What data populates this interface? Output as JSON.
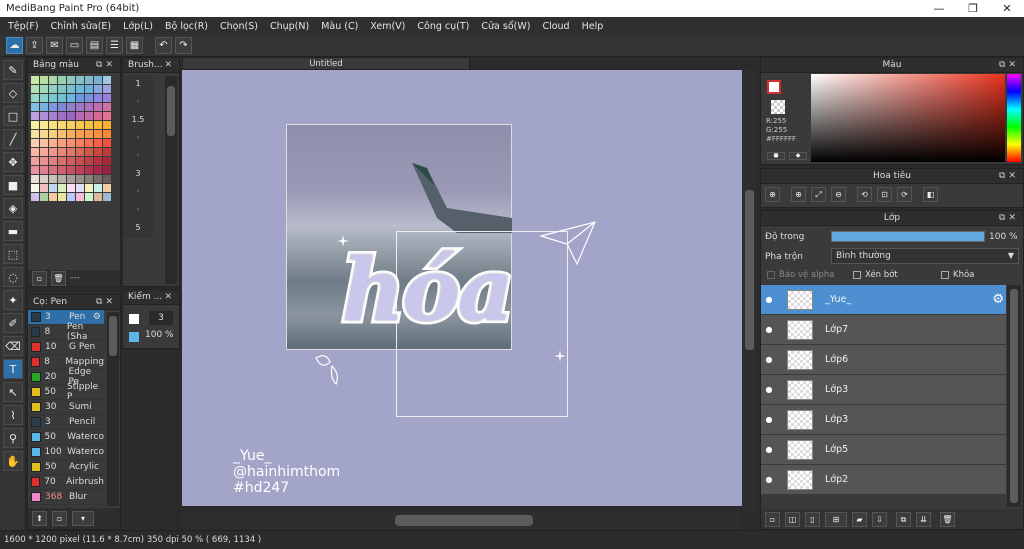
{
  "window": {
    "title": "MediBang Paint Pro (64bit)",
    "minimize": "—",
    "maximize": "❐",
    "close": "✕"
  },
  "menu": [
    "Tệp(F)",
    "Chỉnh sửa(E)",
    "Lớp(L)",
    "Bộ lọc(R)",
    "Chọn(S)",
    "Chụp(N)",
    "Màu (C)",
    "Xem(V)",
    "Công cụ(T)",
    "Cửa sổ(W)",
    "Cloud",
    "Help"
  ],
  "colors_panel": {
    "title": "Bảng màu"
  },
  "brush_panel": {
    "title": "Brush...",
    "sizes": [
      "1",
      "·",
      "1.5",
      "·",
      "·",
      "3",
      "·",
      "·",
      "5"
    ]
  },
  "tools_panel": {
    "title": "Cọ: Pen",
    "tools": [
      {
        "num": "3",
        "name": "Pen",
        "color": "#2a3b4a",
        "selected": true
      },
      {
        "num": "8",
        "name": "Pen (Sha",
        "color": "#2a3b4a"
      },
      {
        "num": "10",
        "name": "G Pen",
        "color": "#e03030"
      },
      {
        "num": "8",
        "name": "Mapping",
        "color": "#e03030"
      },
      {
        "num": "20",
        "name": "Edge Pe",
        "color": "#26a626"
      },
      {
        "num": "50",
        "name": "Stipple P",
        "color": "#e0c020"
      },
      {
        "num": "30",
        "name": "Sumi",
        "color": "#e0c020"
      },
      {
        "num": "3",
        "name": "Pencil",
        "color": "#2a3b4a"
      },
      {
        "num": "50",
        "name": "Waterco",
        "color": "#5ab6e8"
      },
      {
        "num": "100",
        "name": "Waterco",
        "color": "#5ab6e8"
      },
      {
        "num": "50",
        "name": "Acrylic",
        "color": "#e0c020"
      },
      {
        "num": "70",
        "name": "Airbrush",
        "color": "#e03030"
      },
      {
        "num": "368",
        "name": "Blur",
        "color": "#ee88cc"
      }
    ]
  },
  "kiem_panel": {
    "title": "Kiểm ...",
    "size": "3",
    "opacity": "100 %"
  },
  "document": {
    "tab": "Untitled",
    "artwork_text": "hóa",
    "signature": [
      "_Yue_",
      "@hainhimthom",
      "#hd247"
    ]
  },
  "color_panel": {
    "title": "Màu",
    "r": "R:255",
    "g": "G:255",
    "hex": "#FFFFFF"
  },
  "navigator": {
    "title": "Hoa tiêu"
  },
  "layer_panel": {
    "title": "Lớp",
    "opacity_label": "Độ trong",
    "opacity_value": "100 %",
    "opacity_fraction": 1.0,
    "blend_label": "Pha trộn",
    "blend_value": "Bình thường",
    "protect_alpha": "Bảo vệ alpha",
    "clipping": "Xén bớt",
    "lock": "Khóa",
    "layers": [
      {
        "name": "_Yue_",
        "selected": true
      },
      {
        "name": "Lớp7"
      },
      {
        "name": "Lớp6"
      },
      {
        "name": "Lớp3"
      },
      {
        "name": "Lớp3"
      },
      {
        "name": "Lớp5"
      },
      {
        "name": "Lớp2"
      }
    ]
  },
  "status": {
    "text": "1600 * 1200 pixel   (11.6 * 8.7cm)   350 dpi   50 %   ( 669, 1134 )"
  }
}
